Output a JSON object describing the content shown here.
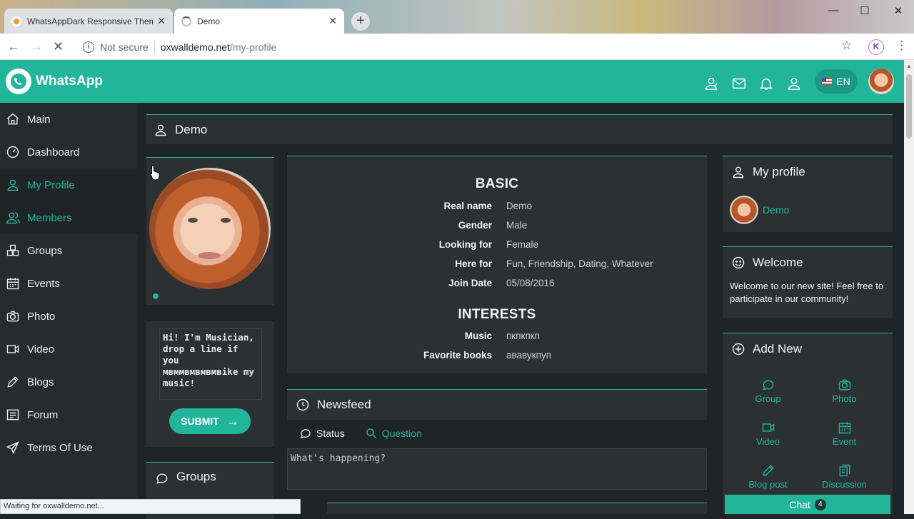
{
  "browser": {
    "tabs": [
      {
        "title": "WhatsAppDark Responsive Them",
        "active": false
      },
      {
        "title": "Demo",
        "active": true
      }
    ],
    "security_label": "Not secure",
    "url_host": "oxwalldemo.net",
    "url_path": "/my-profile",
    "profile_initial": "K",
    "status_text": "Waiting for oxwalldemo.net..."
  },
  "header": {
    "brand": "WhatsApp",
    "language": "EN"
  },
  "sidebar": {
    "items": [
      {
        "label": "Main",
        "icon": "home-icon",
        "active": false
      },
      {
        "label": "Dashboard",
        "icon": "dashboard-icon",
        "active": false
      },
      {
        "label": "My Profile",
        "icon": "user-icon",
        "active": true
      },
      {
        "label": "Members",
        "icon": "members-icon",
        "active": true
      },
      {
        "label": "Groups",
        "icon": "groups-icon",
        "active": false
      },
      {
        "label": "Events",
        "icon": "calendar-icon",
        "active": false
      },
      {
        "label": "Photo",
        "icon": "camera-icon",
        "active": false
      },
      {
        "label": "Video",
        "icon": "video-icon",
        "active": false
      },
      {
        "label": "Blogs",
        "icon": "pencil-icon",
        "active": false
      },
      {
        "label": "Forum",
        "icon": "forum-icon",
        "active": false
      },
      {
        "label": "Terms Of Use",
        "icon": "send-icon",
        "active": false
      }
    ]
  },
  "page": {
    "title": "Demo",
    "status_message": "Hi! I'm Musician, drop a line if you мвммвмвмвмвike my music!",
    "submit_label": "SUBMIT",
    "groups_title": "Groups"
  },
  "profile": {
    "basic_title": "BASIC",
    "basic": [
      {
        "key": "Real name",
        "value": "Demo"
      },
      {
        "key": "Gender",
        "value": "Male"
      },
      {
        "key": "Looking for",
        "value": "Female"
      },
      {
        "key": "Here for",
        "value": "Fun, Friendship, Dating, Whatever"
      },
      {
        "key": "Join Date",
        "value": "05/08/2016"
      }
    ],
    "interests_title": "INTERESTS",
    "interests": [
      {
        "key": "Music",
        "value": "пкпкпкп"
      },
      {
        "key": "Favorite books",
        "value": "ававукпуп"
      }
    ]
  },
  "newsfeed": {
    "title": "Newsfeed",
    "tabs": [
      {
        "label": "Status",
        "active": false
      },
      {
        "label": "Question",
        "active": true
      }
    ],
    "placeholder": "What's happening?"
  },
  "right": {
    "my_profile_title": "My profile",
    "user_name": "Demo",
    "welcome_title": "Welcome",
    "welcome_text": "Welcome to our new site! Feel free to participate in our community!",
    "add_new_title": "Add New",
    "add_new_items": [
      {
        "label": "Group",
        "icon": "chat-bubble-icon"
      },
      {
        "label": "Photo",
        "icon": "camera-icon"
      },
      {
        "label": "Video",
        "icon": "video-icon"
      },
      {
        "label": "Event",
        "icon": "calendar-icon"
      },
      {
        "label": "Blog post",
        "icon": "pencil-icon"
      },
      {
        "label": "Discussion",
        "icon": "discussion-icon"
      }
    ],
    "chat_label": "Chat",
    "chat_count": "4"
  },
  "colors": {
    "accent": "#21b59c",
    "sidebar_bg": "#262b2d",
    "panel_bg": "#2b3133",
    "page_bg": "#1f2426"
  }
}
